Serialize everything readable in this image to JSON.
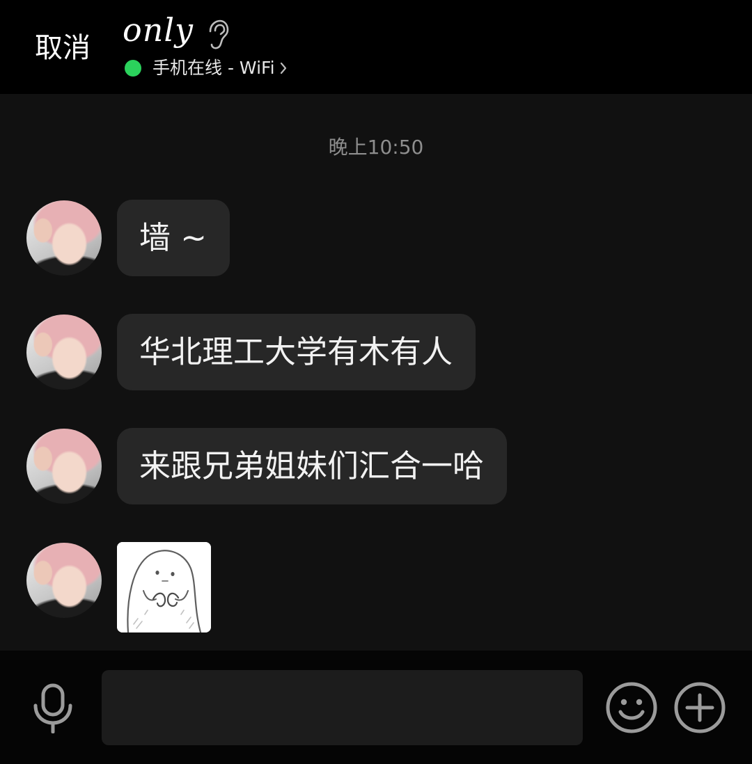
{
  "header": {
    "cancel_label": "取消",
    "title": "only",
    "title_icon": "ear-icon",
    "status_text": "手机在线 - WiFi",
    "status_icon": "chevron-right-icon",
    "status_color": "#2bd25c"
  },
  "chat": {
    "timestamp": "晚上10:50",
    "messages": [
      {
        "text": "墙 ~"
      },
      {
        "text": "华北理工大学有木有人"
      },
      {
        "text": "来跟兄弟姐妹们汇合一哈"
      },
      {
        "sticker_icon": "ghost-sticker"
      }
    ]
  },
  "composer": {
    "icons": [
      "microphone-icon",
      "emoji-icon",
      "plus-icon"
    ]
  },
  "colors": {
    "header_bg": "#000000",
    "chat_bg": "#111111",
    "bubble_bg": "#272727",
    "timestamp": "#8e8e8e",
    "icon": "#9b9b9b"
  }
}
